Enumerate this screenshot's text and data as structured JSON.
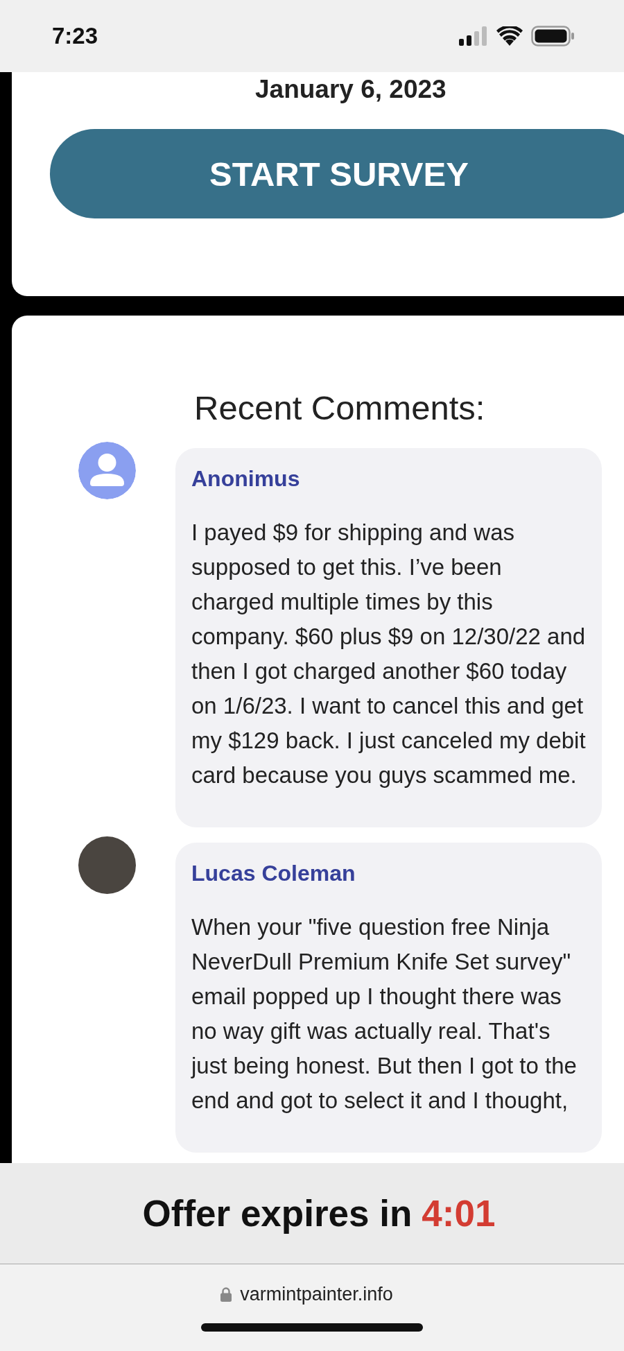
{
  "status_bar": {
    "time": "7:23"
  },
  "survey_card": {
    "date": "January 6, 2023",
    "button": "START SURVEY"
  },
  "comments_section": {
    "title": "Recent Comments:",
    "comments": [
      {
        "kind": "icon",
        "name": "Anonimus",
        "text": "I payed $9 for shipping and was supposed to get this. I’ve been charged multiple times by this company. $60 plus $9 on 12/30/22 and then I got charged another $60 today on 1/6/23. I want to cancel this and get my $129 back. I just canceled my debit card because you guys scammed me."
      },
      {
        "kind": "photo",
        "name": "Lucas Coleman",
        "text": "When your \"five question free Ninja NeverDull Premium Knife Set survey\" email popped up I thought there was no way gift was actually real. That's just being honest. But then I got to the end and got to select it and I thought,"
      }
    ]
  },
  "offer_banner": {
    "label": "Offer expires in",
    "countdown": "4:01"
  },
  "browser_bar": {
    "url": "varmintpainter.info"
  }
}
